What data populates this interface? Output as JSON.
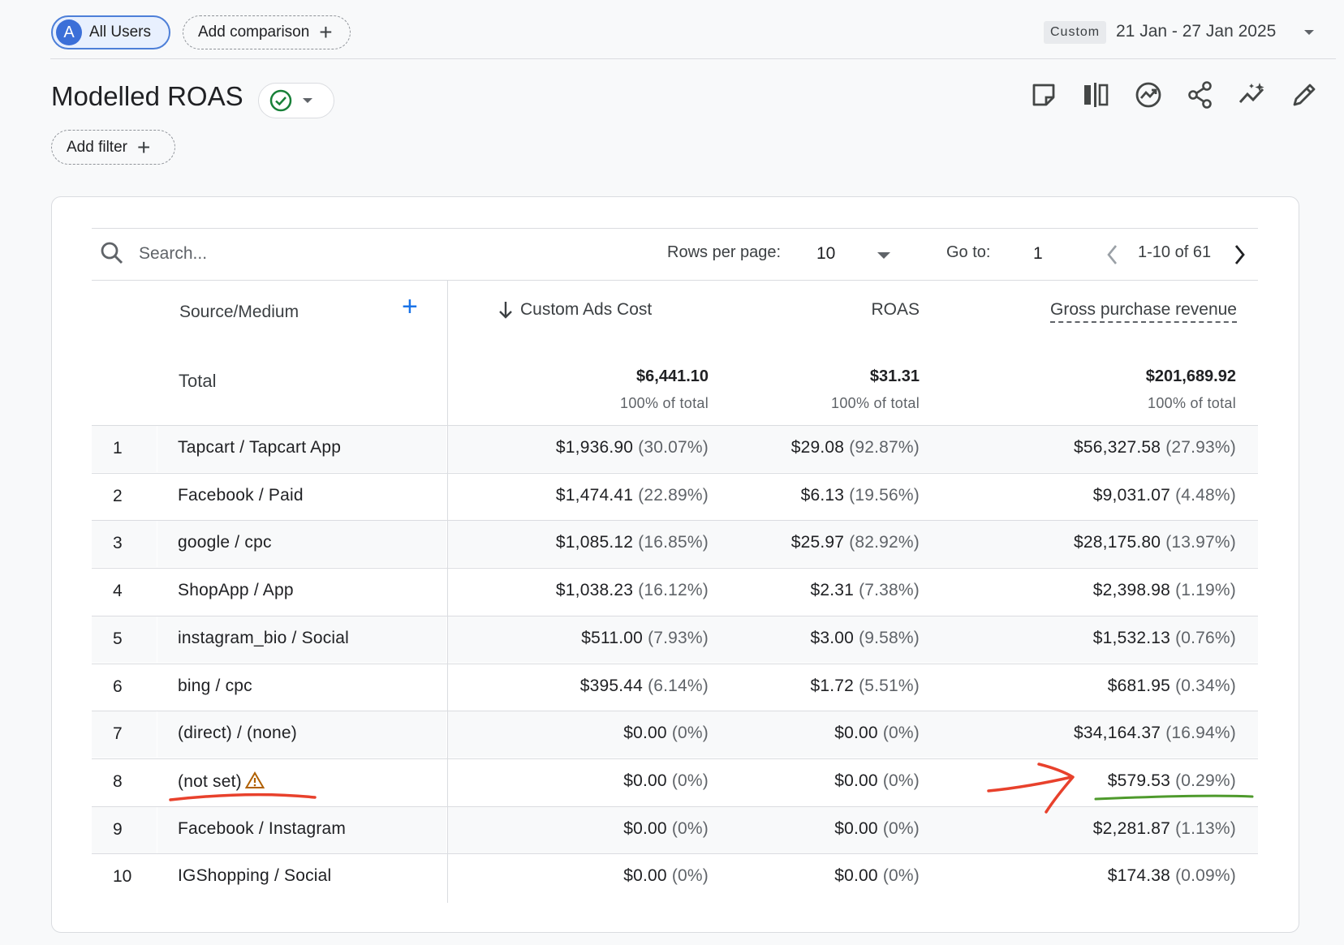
{
  "topbar": {
    "segment": {
      "avatar_letter": "A",
      "label": "All Users"
    },
    "add_comparison_label": "Add comparison",
    "date": {
      "badge": "Custom",
      "range": "21 Jan - 27 Jan 2025"
    }
  },
  "report": {
    "title": "Modelled ROAS",
    "status": "check-circle-icon",
    "add_filter_label": "Add filter",
    "toolbar_icons": [
      "sticky-note-icon",
      "compare-columns-icon",
      "insights-icon",
      "share-icon",
      "trending-icon",
      "edit-icon"
    ]
  },
  "table": {
    "search_placeholder": "Search...",
    "rows_per_page_label": "Rows per page:",
    "rows_per_page_value": "10",
    "goto_label": "Go to:",
    "goto_value": "1",
    "pagination": "1-10 of 61",
    "columns": {
      "dimension": "Source/Medium",
      "cost": "Custom Ads Cost",
      "roas": "ROAS",
      "revenue": "Gross purchase revenue"
    },
    "sorted_column": "cost",
    "sort_direction": "descending",
    "totals": {
      "label": "Total",
      "cost": "$6,441.10",
      "cost_pct": "100% of total",
      "roas": "$31.31",
      "roas_pct": "100% of total",
      "revenue": "$201,689.92",
      "revenue_pct": "100% of total"
    },
    "rows": [
      {
        "idx": "1",
        "source": "Tapcart / Tapcart App",
        "cost": "$1,936.90",
        "cost_pct": "(30.07%)",
        "roas": "$29.08",
        "roas_pct": "(92.87%)",
        "revenue": "$56,327.58",
        "revenue_pct": "(27.93%)"
      },
      {
        "idx": "2",
        "source": "Facebook / Paid",
        "cost": "$1,474.41",
        "cost_pct": "(22.89%)",
        "roas": "$6.13",
        "roas_pct": "(19.56%)",
        "revenue": "$9,031.07",
        "revenue_pct": "(4.48%)"
      },
      {
        "idx": "3",
        "source": "google / cpc",
        "cost": "$1,085.12",
        "cost_pct": "(16.85%)",
        "roas": "$25.97",
        "roas_pct": "(82.92%)",
        "revenue": "$28,175.80",
        "revenue_pct": "(13.97%)"
      },
      {
        "idx": "4",
        "source": "ShopApp / App",
        "cost": "$1,038.23",
        "cost_pct": "(16.12%)",
        "roas": "$2.31",
        "roas_pct": "(7.38%)",
        "revenue": "$2,398.98",
        "revenue_pct": "(1.19%)"
      },
      {
        "idx": "5",
        "source": "instagram_bio / Social",
        "cost": "$511.00",
        "cost_pct": "(7.93%)",
        "roas": "$3.00",
        "roas_pct": "(9.58%)",
        "revenue": "$1,532.13",
        "revenue_pct": "(0.76%)"
      },
      {
        "idx": "6",
        "source": "bing / cpc",
        "cost": "$395.44",
        "cost_pct": "(6.14%)",
        "roas": "$1.72",
        "roas_pct": "(5.51%)",
        "revenue": "$681.95",
        "revenue_pct": "(0.34%)"
      },
      {
        "idx": "7",
        "source": "(direct) / (none)",
        "cost": "$0.00",
        "cost_pct": "(0%)",
        "roas": "$0.00",
        "roas_pct": "(0%)",
        "revenue": "$34,164.37",
        "revenue_pct": "(16.94%)"
      },
      {
        "idx": "8",
        "source": "(not set)",
        "warning": true,
        "cost": "$0.00",
        "cost_pct": "(0%)",
        "roas": "$0.00",
        "roas_pct": "(0%)",
        "revenue": "$579.53",
        "revenue_pct": "(0.29%)"
      },
      {
        "idx": "9",
        "source": "Facebook / Instagram",
        "cost": "$0.00",
        "cost_pct": "(0%)",
        "roas": "$0.00",
        "roas_pct": "(0%)",
        "revenue": "$2,281.87",
        "revenue_pct": "(1.13%)"
      },
      {
        "idx": "10",
        "source": "IGShopping / Social",
        "cost": "$0.00",
        "cost_pct": "(0%)",
        "roas": "$0.00",
        "roas_pct": "(0%)",
        "revenue": "$174.38",
        "revenue_pct": "(0.09%)"
      }
    ]
  },
  "annotations": {
    "underline_not_set_color": "#e8412c",
    "arrow_color": "#e8412c",
    "underline_revenue_color": "#4e9a2c"
  },
  "colors": {
    "accent": "#1a73e8",
    "segment_chip": "#4d7fd8",
    "success": "#188038",
    "warning": "#b06000"
  }
}
